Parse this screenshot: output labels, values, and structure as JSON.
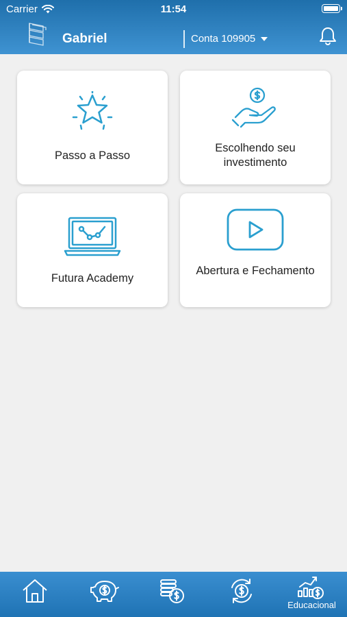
{
  "status_bar": {
    "carrier": "Carrier",
    "time": "11:54"
  },
  "header": {
    "user_name": "Gabriel",
    "account_label": "Conta 109905",
    "icons": {
      "logo": "brand-logo-icon",
      "notifications": "bell-icon"
    }
  },
  "cards": [
    {
      "label": "Passo a Passo",
      "icon": "star-icon"
    },
    {
      "label": "Escolhendo seu investimento",
      "icon": "hand-coin-icon"
    },
    {
      "label": "Futura Academy",
      "icon": "laptop-chart-icon"
    },
    {
      "label": "Abertura e Fechamento",
      "icon": "video-play-icon"
    }
  ],
  "bottom_nav": {
    "items": [
      {
        "icon": "home-icon"
      },
      {
        "icon": "piggy-bank-icon"
      },
      {
        "icon": "coins-icon"
      },
      {
        "icon": "coin-exchange-icon"
      },
      {
        "icon": "education-chart-icon",
        "label": "Educacional",
        "active": true
      }
    ]
  },
  "colors": {
    "accent": "#2a9fcf",
    "header": "#2f84c4",
    "background": "#f0f0f0"
  }
}
